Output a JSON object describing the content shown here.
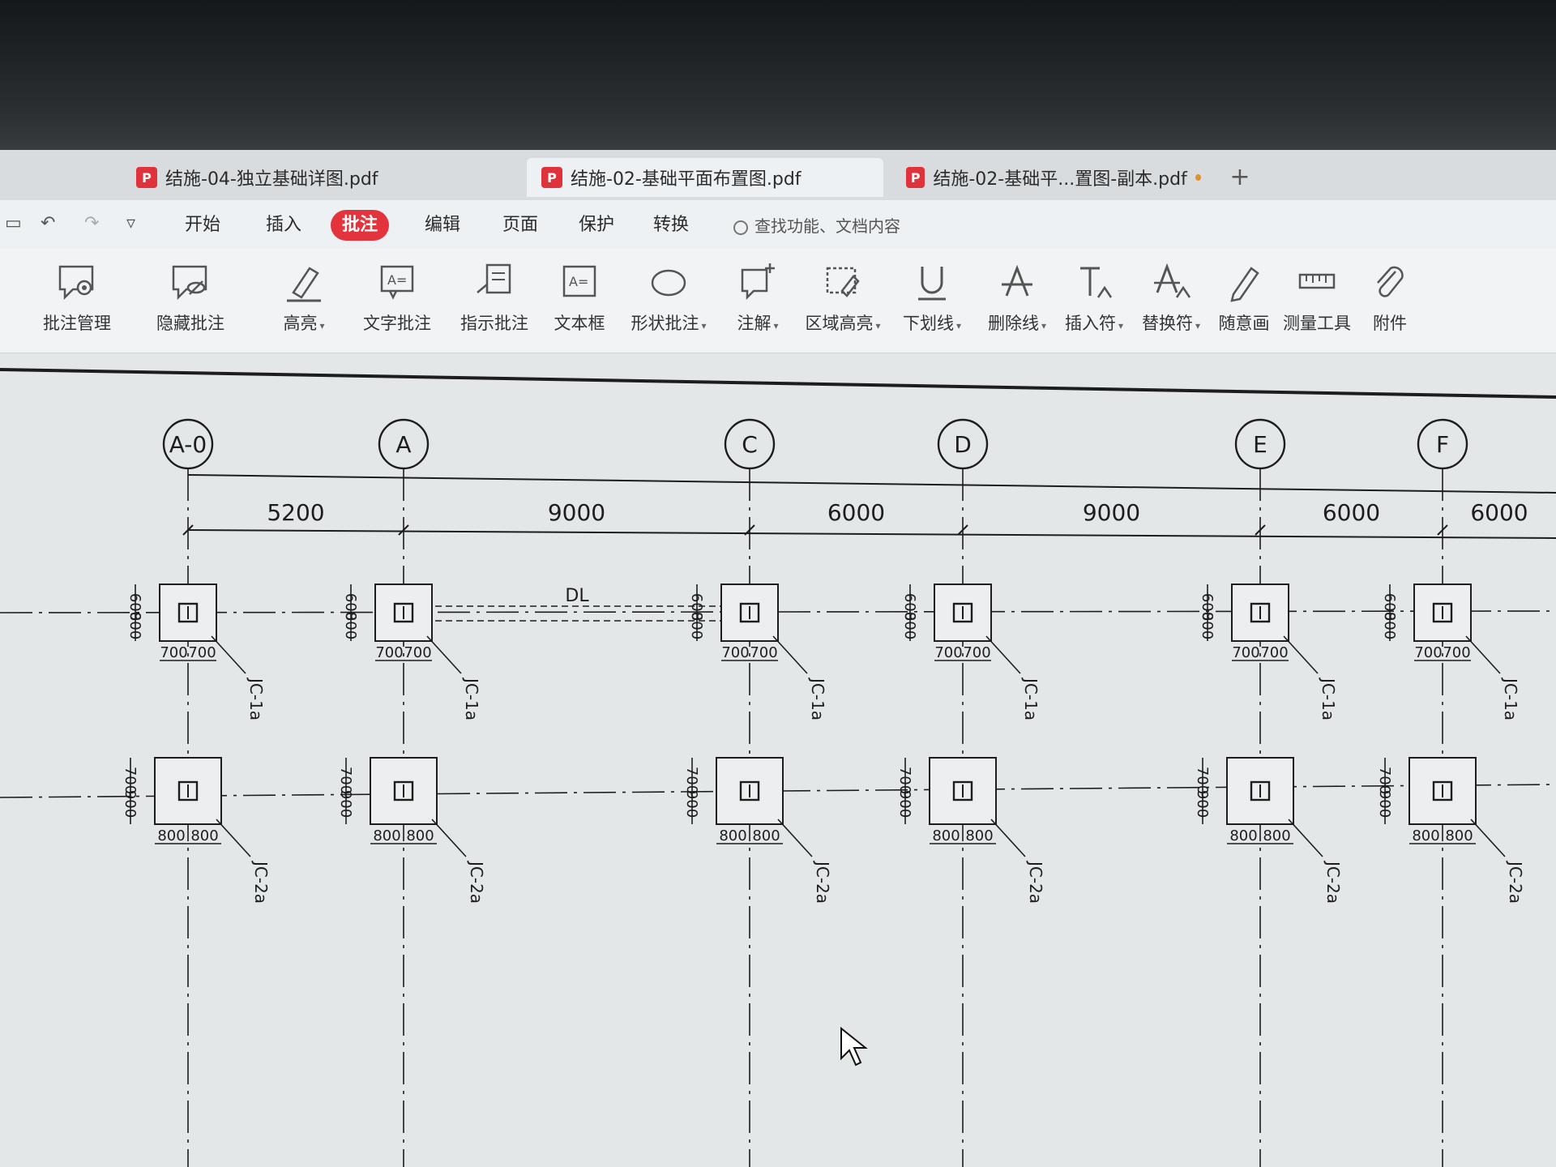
{
  "tabs": [
    {
      "label": "结施-04-独立基础详图.pdf",
      "active": false
    },
    {
      "label": "结施-02-基础平面布置图.pdf",
      "active": true
    },
    {
      "label": "结施-02-基础平...置图-副本.pdf",
      "active": false
    }
  ],
  "new_tab": "+",
  "menu": {
    "items": [
      "开始",
      "插入",
      "批注",
      "编辑",
      "页面",
      "保护",
      "转换"
    ],
    "active": "批注",
    "search_placeholder": "查找功能、文档内容"
  },
  "ribbon": {
    "tools": [
      {
        "label": "批注管理",
        "icon": "comment-gear-icon",
        "dropdown": false
      },
      {
        "label": "隐藏批注",
        "icon": "comment-hide-icon",
        "dropdown": false
      },
      {
        "label": "高亮",
        "icon": "highlighter-icon",
        "dropdown": true
      },
      {
        "label": "文字批注",
        "icon": "text-comment-icon",
        "dropdown": false
      },
      {
        "label": "指示批注",
        "icon": "callout-comment-icon",
        "dropdown": false
      },
      {
        "label": "文本框",
        "icon": "textbox-icon",
        "dropdown": false
      },
      {
        "label": "形状批注",
        "icon": "ellipse-icon",
        "dropdown": true
      },
      {
        "label": "注解",
        "icon": "note-add-icon",
        "dropdown": true
      },
      {
        "label": "区域高亮",
        "icon": "area-highlight-icon",
        "dropdown": true
      },
      {
        "label": "下划线",
        "icon": "underline-icon",
        "dropdown": true
      },
      {
        "label": "删除线",
        "icon": "strikethrough-icon",
        "dropdown": true
      },
      {
        "label": "插入符",
        "icon": "insert-caret-icon",
        "dropdown": true
      },
      {
        "label": "替换符",
        "icon": "replace-caret-icon",
        "dropdown": true
      },
      {
        "label": "随意画",
        "icon": "pen-icon",
        "dropdown": false
      },
      {
        "label": "测量工具",
        "icon": "ruler-icon",
        "dropdown": false
      },
      {
        "label": "附件",
        "icon": "paperclip-icon",
        "dropdown": false
      }
    ]
  },
  "drawing": {
    "axes": [
      "A-0",
      "A",
      "C",
      "D",
      "E",
      "F"
    ],
    "spans": [
      "5200",
      "9000",
      "6000",
      "9000",
      "6000",
      "6000"
    ],
    "beam_label": "DL",
    "row1": {
      "dims_v": [
        "600",
        "800"
      ],
      "dims_h": [
        "700",
        "700"
      ],
      "label": "JC-1a"
    },
    "row2": {
      "dims_v": [
        "700",
        "900"
      ],
      "dims_h": [
        "800",
        "800"
      ],
      "label": "JC-2a"
    }
  }
}
